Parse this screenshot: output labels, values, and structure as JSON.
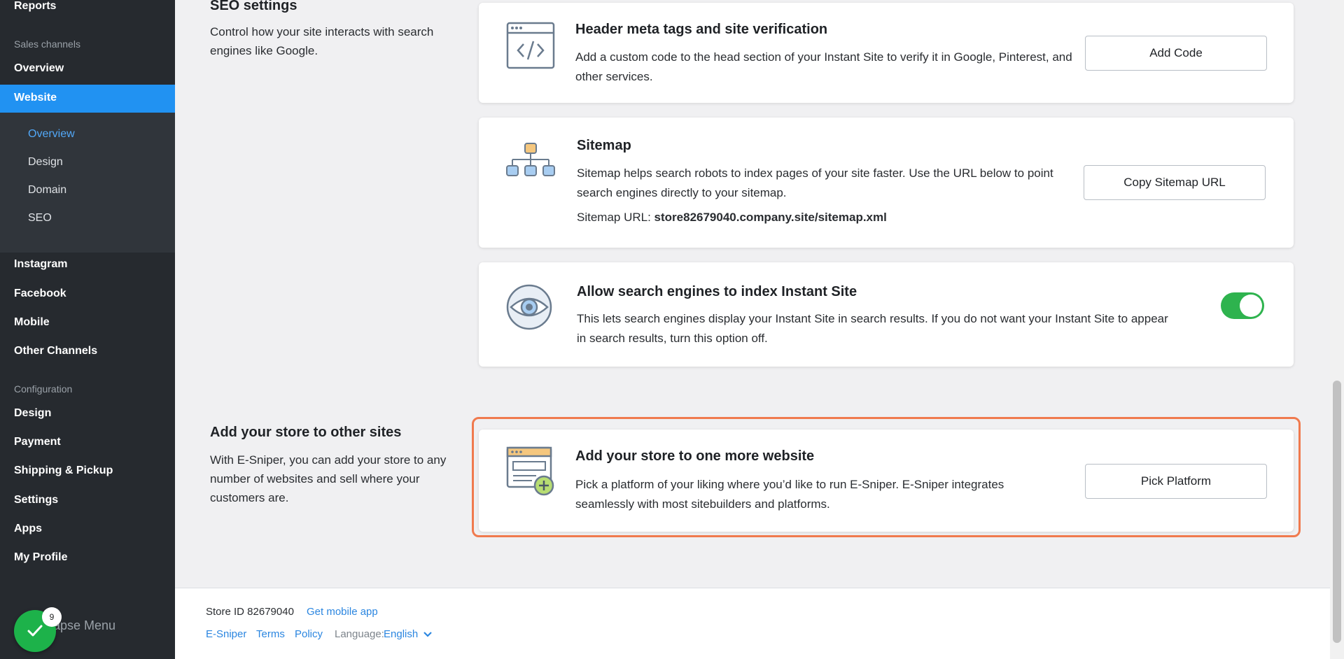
{
  "sidebar": {
    "reports": "Reports",
    "sales_channels_section": "Sales channels",
    "overview": "Overview",
    "website": "Website",
    "website_submenu": [
      "Overview",
      "Design",
      "Domain",
      "SEO"
    ],
    "instagram": "Instagram",
    "facebook": "Facebook",
    "mobile": "Mobile",
    "other_channels": "Other Channels",
    "configuration_section": "Configuration",
    "design": "Design",
    "payment": "Payment",
    "shipping": "Shipping & Pickup",
    "settings": "Settings",
    "apps": "Apps",
    "my_profile": "My Profile",
    "collapse_menu": "lapse Menu",
    "notification_count": "9"
  },
  "seo_section": {
    "title": "SEO settings",
    "description": "Control how your site interacts with search engines like Google."
  },
  "cards": {
    "header_meta": {
      "title": "Header meta tags and site verification",
      "description": "Add a custom code to the head section of your Instant Site to verify it in Google, Pinterest, and other services.",
      "button": "Add Code",
      "icon": "code-window-icon"
    },
    "sitemap": {
      "title": "Sitemap",
      "description": "Sitemap helps search robots to index pages of your site faster. Use the URL below to point search engines directly to your sitemap.",
      "url_label": "Sitemap URL: ",
      "url": "store82679040.company.site/sitemap.xml",
      "button": "Copy Sitemap URL",
      "icon": "sitemap-icon"
    },
    "index": {
      "title": "Allow search engines to index Instant Site",
      "description": "This lets search engines display your Instant Site in search results. If you do not want your Instant Site to appear in search results, turn this option off.",
      "toggle_on": true,
      "icon": "eye-icon"
    }
  },
  "other_sites_section": {
    "title": "Add your store to other sites",
    "description": "With E-Sniper, you can add your store to any number of websites and sell where your customers are.",
    "card": {
      "title": "Add your store to one more website",
      "description": "Pick a platform of your liking where you’d like to run E-Sniper. E-Sniper integrates seamlessly with most sitebuilders and platforms.",
      "button": "Pick Platform",
      "icon": "add-website-icon"
    }
  },
  "footer": {
    "store_id": "Store ID 82679040",
    "get_mobile_app": "Get mobile app",
    "brand": "E-Sniper",
    "terms": "Terms",
    "policy": "Policy",
    "language_label": "Language:",
    "language_value": "English"
  },
  "colors": {
    "sidebar_bg": "#262a2f",
    "active_nav": "#2192f2",
    "toggle_on": "#2eb34e",
    "highlight_border": "#f07a4e",
    "link": "#2b86e0"
  }
}
